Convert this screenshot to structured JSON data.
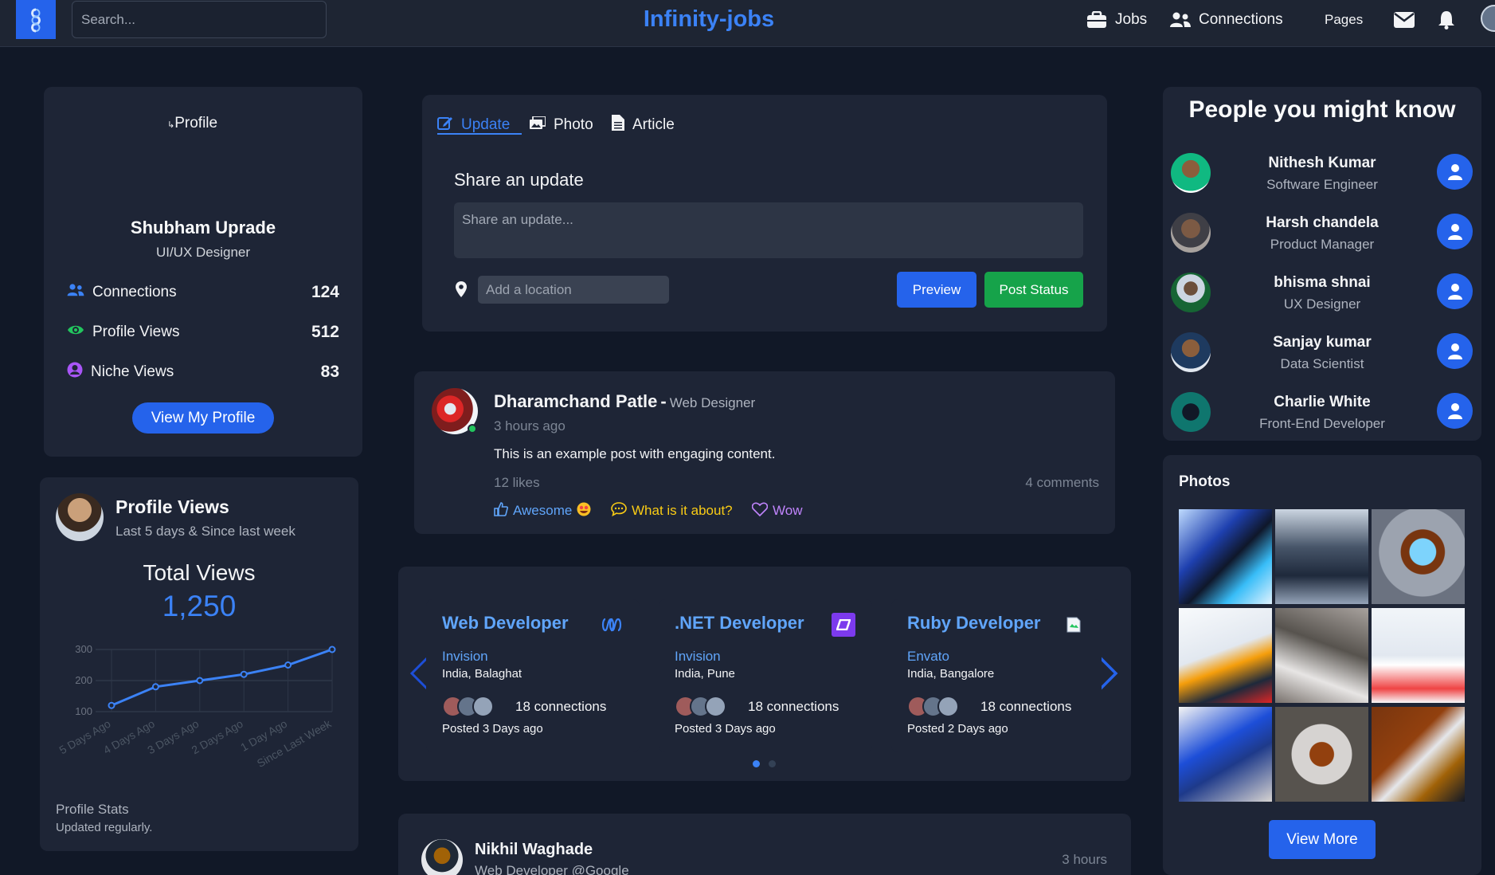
{
  "navbar": {
    "brand": "Infinity-jobs",
    "search_placeholder": "Search...",
    "items": [
      {
        "label": "Jobs",
        "icon": "briefcase-icon"
      },
      {
        "label": "Connections",
        "icon": "users-icon"
      },
      {
        "label": "Pages",
        "icon": ""
      }
    ],
    "icons": [
      "envelope-icon",
      "bell-icon",
      "avatar"
    ]
  },
  "profile": {
    "image_alt": "Profile",
    "name": "Shubham Uprade",
    "role": "UI/UX Designer",
    "stats": [
      {
        "label": "Connections",
        "value": "124",
        "icon": "users-icon",
        "color": "#3b82f6"
      },
      {
        "label": "Profile Views",
        "value": "512",
        "icon": "eye-icon",
        "color": "#22c55e"
      },
      {
        "label": "Niche Views",
        "value": "83",
        "icon": "user-circle-icon",
        "color": "#a855f7"
      }
    ],
    "button": "View My Profile"
  },
  "profile_views": {
    "title": "Profile Views",
    "subtitle": "Last 5 days & Since last week",
    "total_label": "Total Views",
    "total_value": "1,250",
    "footer_title": "Profile Stats",
    "footer_sub": "Updated regularly."
  },
  "chart_data": {
    "type": "line",
    "categories": [
      "5 Days Ago",
      "4 Days Ago",
      "3 Days Ago",
      "2 Days Ago",
      "1 Day Ago",
      "Since Last Week"
    ],
    "series": [
      {
        "values": [
          120,
          180,
          200,
          220,
          250,
          300
        ]
      }
    ],
    "yticks": [
      "300",
      "200",
      "100"
    ],
    "ylim": [
      100,
      300
    ],
    "grid": true,
    "color": "#3b82f6"
  },
  "composer": {
    "tabs": [
      "Update",
      "Photo",
      "Article"
    ],
    "title": "Share an update",
    "placeholder": "Share an update...",
    "location_placeholder": "Add a location",
    "preview": "Preview",
    "post": "Post Status"
  },
  "post": {
    "author": "Dharamchand Patle",
    "separator": "-",
    "role": "Web Designer",
    "time": "3 hours ago",
    "content": "This is an example post with engaging content.",
    "likes": "12 likes",
    "comments": "4 comments",
    "reactions": [
      {
        "label": "Awesome",
        "color": "#60a5fa"
      },
      {
        "label": "What is it about?",
        "color": "#facc15"
      },
      {
        "label": "Wow",
        "color": "#c084fc"
      }
    ]
  },
  "jobs": [
    {
      "title": "Web Developer",
      "company": "Invision",
      "location": "India, Balaghat",
      "connections": "18 connections",
      "posted": "Posted 3 Days ago"
    },
    {
      "title": ".NET Developer",
      "company": "Invision",
      "location": "India, Pune",
      "connections": "18 connections",
      "posted": "Posted 3 Days ago"
    },
    {
      "title": "Ruby Developer",
      "company": "Envato",
      "location": "India, Bangalore",
      "connections": "18 connections",
      "posted": "Posted 2 Days ago"
    }
  ],
  "next_post": {
    "author": "Nikhil Waghade",
    "role": "Web Developer @Google",
    "time": "3 hours"
  },
  "people": {
    "title": "People you might know",
    "list": [
      {
        "name": "Nithesh Kumar",
        "role": "Software Engineer"
      },
      {
        "name": "Harsh chandela",
        "role": "Product Manager"
      },
      {
        "name": "bhisma shnai",
        "role": "UX Designer"
      },
      {
        "name": "Sanjay kumar",
        "role": "Data Scientist"
      },
      {
        "name": "Charlie White",
        "role": "Front-End Developer"
      }
    ]
  },
  "photos": {
    "title": "Photos",
    "button": "View More"
  }
}
